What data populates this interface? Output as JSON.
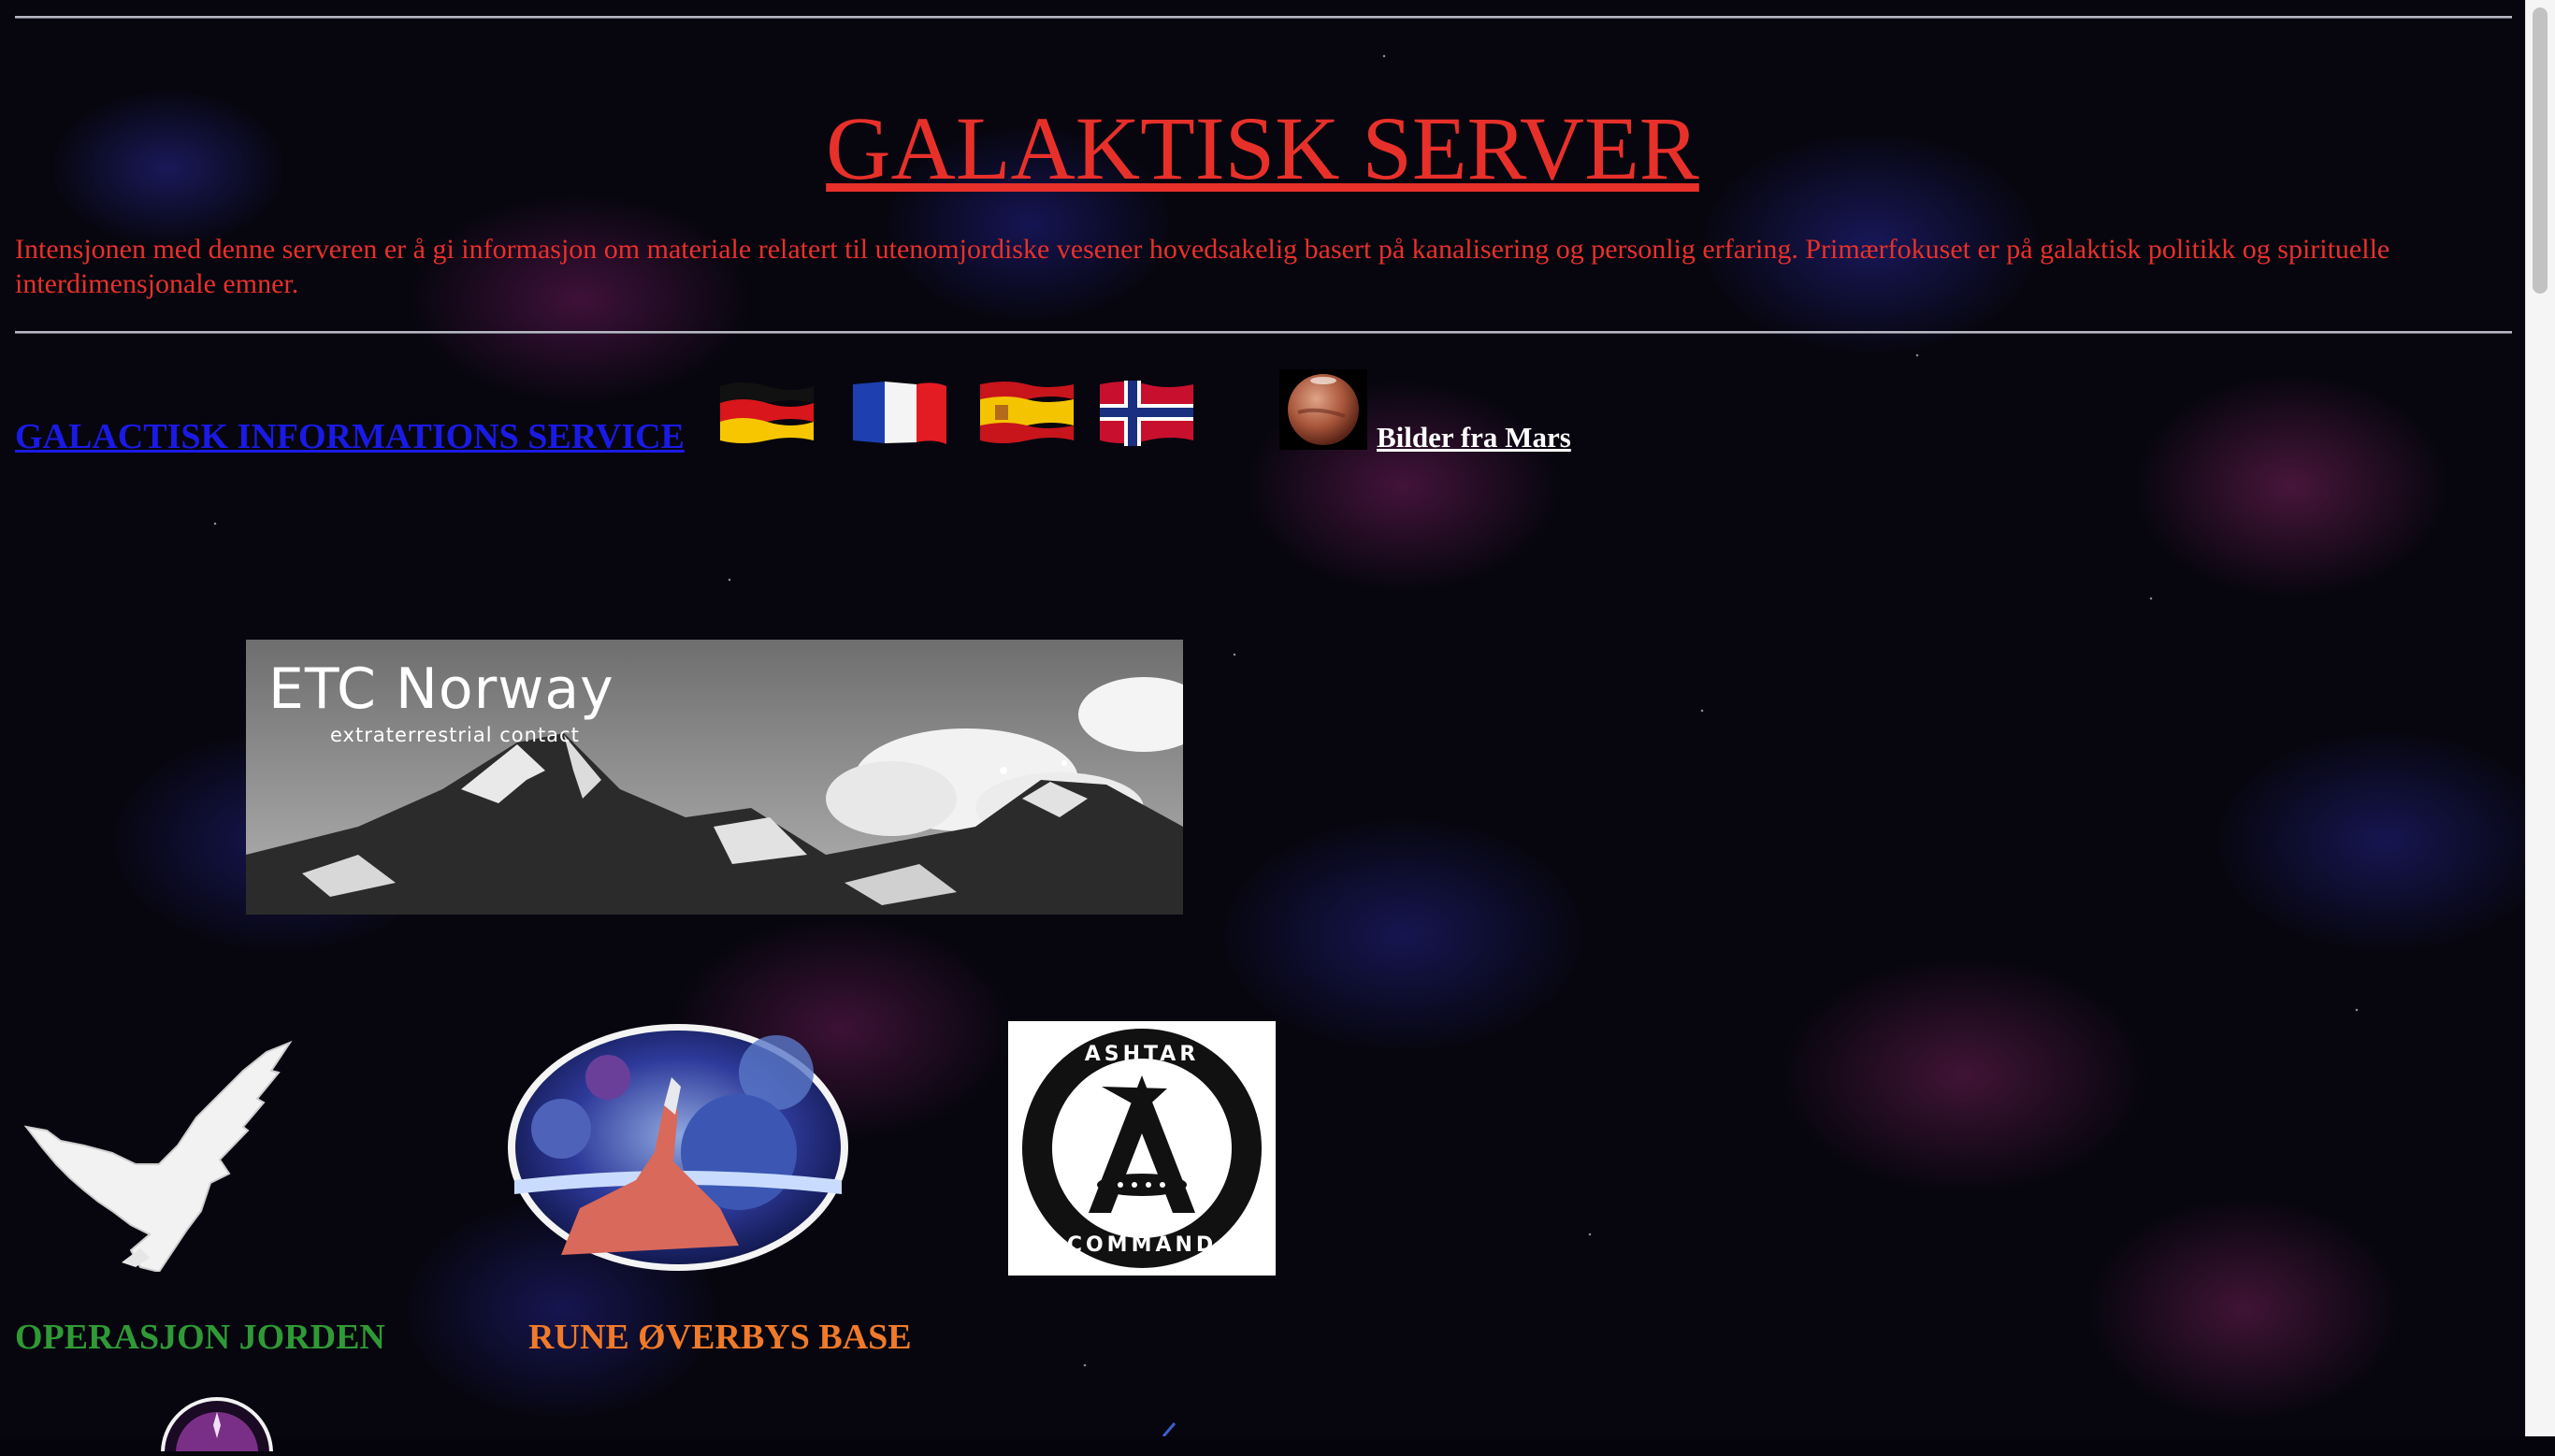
{
  "page": {
    "title": "GALAKTISK SERVER",
    "intro": "Intensjonen med denne serveren er å gi informasjon om materiale relatert til utenomjordiske vesener hovedsakelig basert på kanalisering og personlig erfaring. Primærfokuset er på galaktisk politikk og spirituelle interdimensjonale emner."
  },
  "nav": {
    "gis_link": "GALACTISK INFORMATIONS SERVICE ",
    "flags": [
      "german-flag-icon",
      "french-flag-icon",
      "spanish-flag-icon",
      "norwegian-flag-icon"
    ],
    "mars_link": "Bilder fra Mars"
  },
  "banner": {
    "title": "ETC Norway",
    "subtitle": "extraterrestrial contact"
  },
  "gallery": {
    "caption_operasjon": "OPERASJON JORDEN",
    "caption_rune": "RUNE ØVERBYS BASE",
    "ashtar_top": "ASHTAR",
    "ashtar_bottom": "COMMAND"
  },
  "colors": {
    "title_red": "#e8302a",
    "link_blue": "#1a1ae6",
    "caption_green": "#2f9a35",
    "caption_orange": "#f07a2a"
  }
}
